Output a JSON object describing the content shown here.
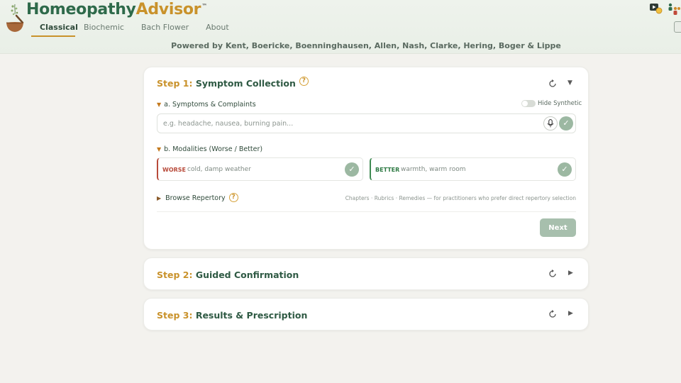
{
  "header": {
    "brand_part1": "Homeopathy",
    "brand_part2": "Advisor",
    "trademark": "™",
    "tabs": [
      {
        "label": "Classical",
        "active": true
      },
      {
        "label": "Biochemic",
        "active": false
      },
      {
        "label": "Bach Flower",
        "active": false
      },
      {
        "label": "About",
        "active": false
      }
    ],
    "powered_by": "Powered by Kent, Boericke, Boenninghausen, Allen, Nash, Clarke, Hering, Boger & Lippe",
    "icons": [
      "video-icon",
      "people-icon"
    ]
  },
  "step1": {
    "num": "Step 1:",
    "name": "Symptom Collection",
    "help": "?",
    "symptoms_label": "a. Symptoms & Complaints",
    "hide_synthetic": "Hide Synthetic",
    "symptom_placeholder": "e.g. headache, nausea, burning pain...",
    "modalities_label": "b. Modalities (Worse / Better)",
    "worse_tag": "WORSE",
    "worse_placeholder": "cold, damp weather",
    "better_tag": "BETTER",
    "better_placeholder": "warmth, warm room",
    "browse_label": "Browse Repertory",
    "browse_note": "Chapters · Rubrics · Remedies — for practitioners who prefer direct repertory selection",
    "next": "Next",
    "check": "✓",
    "caret_open": "▼",
    "caret_closed": "▶"
  },
  "step2": {
    "num": "Step 2:",
    "name": "Guided Confirmation"
  },
  "step3": {
    "num": "Step 3:",
    "name": "Results & Prescription"
  },
  "colors": {
    "accent_gold": "#c9922b",
    "brand_green": "#2e6a4a",
    "worse_red": "#b84a3a",
    "better_green": "#2e7a44",
    "button_sage": "#a7bfad"
  }
}
